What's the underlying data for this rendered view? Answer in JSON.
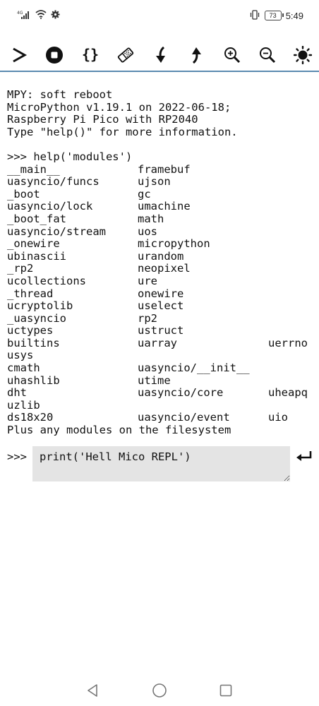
{
  "status_bar": {
    "network_label": "4G",
    "battery": "73",
    "time": "5:49"
  },
  "toolbar": {
    "buttons": [
      "run",
      "stop",
      "code",
      "clear",
      "download",
      "upload",
      "zoom-in",
      "zoom-out",
      "brightness"
    ]
  },
  "terminal": {
    "header_lines": [
      "MPY: soft reboot",
      "MicroPython v1.19.1 on 2022-06-18;",
      "Raspberry Pi Pico with RP2040",
      "Type \"help()\" for more information."
    ],
    "command": ">>> help('modules')",
    "modules": [
      [
        "__main__",
        "framebuf",
        ""
      ],
      [
        "uasyncio/funcs",
        "ujson",
        ""
      ],
      [
        "_boot",
        "gc",
        ""
      ],
      [
        "uasyncio/lock",
        "umachine",
        ""
      ],
      [
        "_boot_fat",
        "math",
        ""
      ],
      [
        "uasyncio/stream",
        "uos",
        ""
      ],
      [
        "_onewire",
        "micropython",
        ""
      ],
      [
        "ubinascii",
        "urandom",
        ""
      ],
      [
        "_rp2",
        "neopixel",
        ""
      ],
      [
        "ucollections",
        "ure",
        ""
      ],
      [
        "_thread",
        "onewire",
        ""
      ],
      [
        "ucryptolib",
        "uselect",
        ""
      ],
      [
        "_uasyncio",
        "rp2",
        ""
      ],
      [
        "uctypes",
        "ustruct",
        ""
      ],
      [
        "builtins",
        "uarray",
        "uerrno"
      ],
      [
        "usys",
        "",
        ""
      ],
      [
        "cmath",
        "uasyncio/__init__",
        ""
      ],
      [
        "uhashlib",
        "utime",
        ""
      ],
      [
        "dht",
        "uasyncio/core",
        "uheapq"
      ],
      [
        "uzlib",
        "",
        ""
      ],
      [
        "ds18x20",
        "uasyncio/event",
        "uio"
      ]
    ],
    "footer": "Plus any modules on the filesystem"
  },
  "repl": {
    "prompt": ">>>",
    "input_value": "print('Hell Mico REPL')"
  },
  "colors": {
    "divider": "#5a8ab0",
    "input_bg": "#e4e4e4"
  }
}
